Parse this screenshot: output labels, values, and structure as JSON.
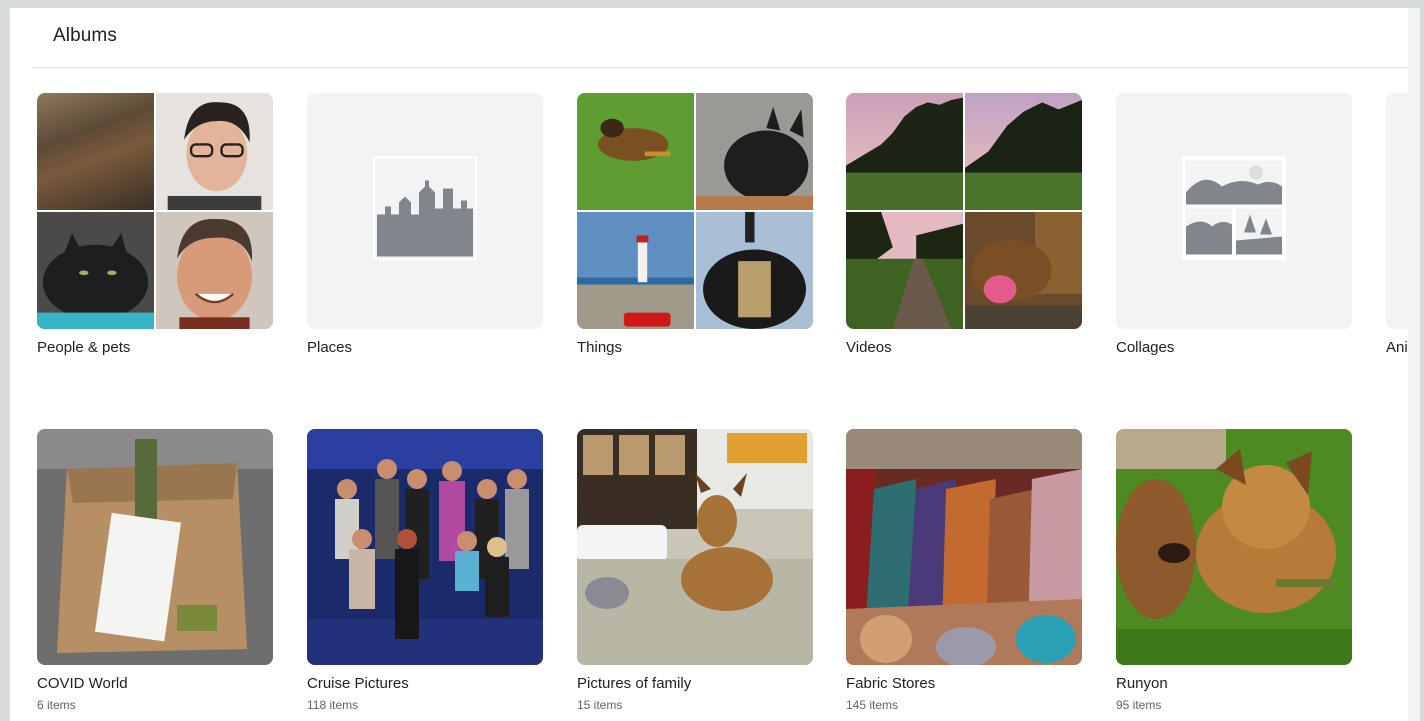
{
  "header": {
    "title": "Albums"
  },
  "row1": [
    {
      "title": "People & pets"
    },
    {
      "title": "Places"
    },
    {
      "title": "Things"
    },
    {
      "title": "Videos"
    },
    {
      "title": "Collages"
    },
    {
      "title": "Anim"
    }
  ],
  "row2": [
    {
      "title": "COVID World",
      "count": "6 items"
    },
    {
      "title": "Cruise Pictures",
      "count": "118 items"
    },
    {
      "title": "Pictures of family",
      "count": "15 items"
    },
    {
      "title": "Fabric Stores",
      "count": "145 items"
    },
    {
      "title": "Runyon",
      "count": "95 items"
    }
  ],
  "icons": {
    "places": "city-skyline-icon",
    "collages": "landscape-collage-icon"
  }
}
